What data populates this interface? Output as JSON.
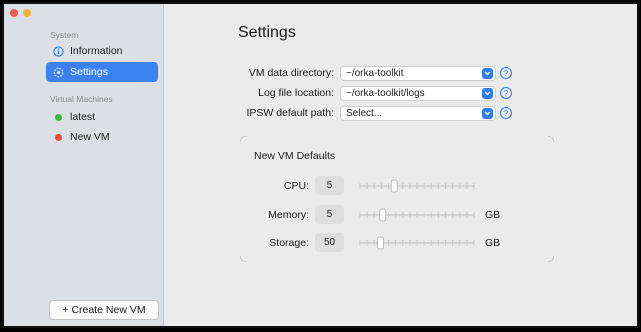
{
  "sidebar": {
    "section_system": "System",
    "items_system": [
      {
        "label": "Information",
        "icon": "info-icon"
      },
      {
        "label": "Settings",
        "icon": "gear-icon",
        "active": true
      }
    ],
    "section_vms": "Virtual Machines",
    "items_vms": [
      {
        "label": "latest",
        "status_color": "#3cb93c"
      },
      {
        "label": "New VM",
        "status_color": "#ea4a3f"
      }
    ],
    "create_button": "+ Create New VM"
  },
  "main": {
    "title": "Settings",
    "paths": [
      {
        "label": "VM data directory:",
        "value": "~/orka-toolkit"
      },
      {
        "label": "Log file location:",
        "value": "~/orka-toolkit/logs"
      },
      {
        "label": "IPSW default path:",
        "value": "Select..."
      }
    ],
    "defaults": {
      "title": "New VM Defaults",
      "fields": [
        {
          "label": "CPU:",
          "value": "5",
          "unit": "",
          "level": 0.3
        },
        {
          "label": "Memory:",
          "value": "5",
          "unit": "GB",
          "level": 0.2
        },
        {
          "label": "Storage:",
          "value": "50",
          "unit": "GB",
          "level": 0.18
        }
      ]
    }
  },
  "colors": {
    "accent": "#3b82f0",
    "sidebar_bg": "#dcdfe3",
    "window_bg": "#ebebeb"
  }
}
